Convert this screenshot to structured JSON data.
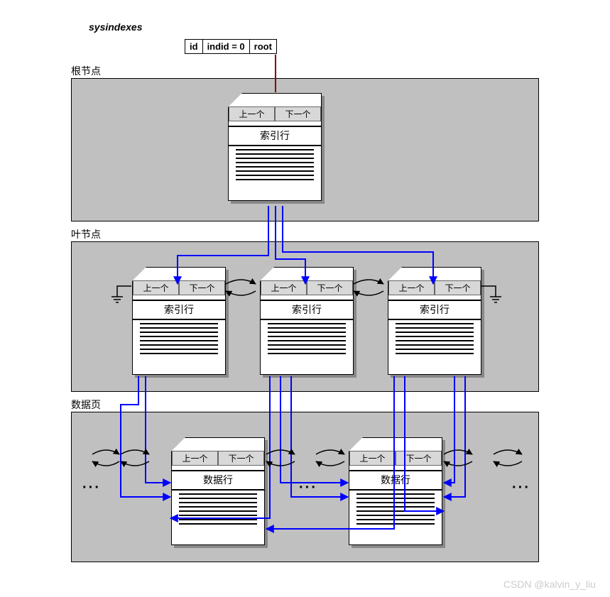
{
  "title": "sysindexes",
  "sysrow": {
    "col1": "id",
    "col2": "indid = 0",
    "col3": "root"
  },
  "sections": {
    "root": "根节点",
    "leaf": "叶节点",
    "data": "数据页"
  },
  "page_labels": {
    "prev": "上一个",
    "next": "下一个",
    "index_rows": "索引行",
    "data_rows": "数据行"
  },
  "watermark": "CSDN @kalvin_y_liu",
  "ellipsis": "···"
}
